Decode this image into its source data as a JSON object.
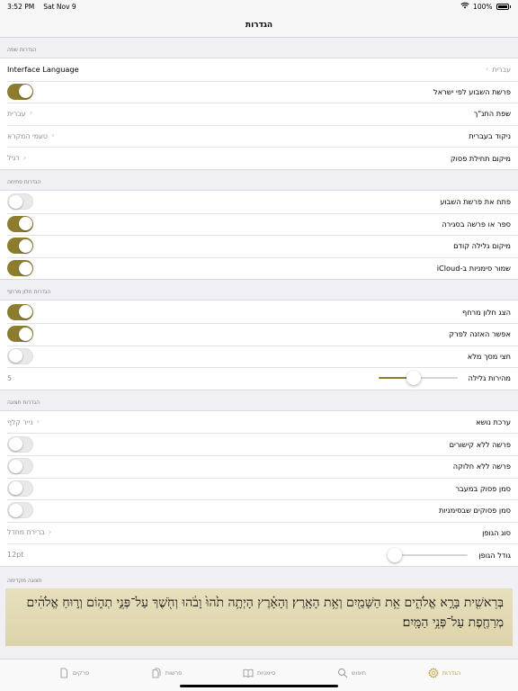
{
  "status": {
    "time": "3:52 PM",
    "date": "Sat Nov 9",
    "battery": "100%"
  },
  "nav": {
    "title": "הגדרות"
  },
  "sections": {
    "language": {
      "header": "הגדרות שפה",
      "interface_language": {
        "label": "Interface Language",
        "value": "עברית"
      },
      "israel_parasha": {
        "label": "פרשת השבוע לפי ישראל"
      },
      "tanakh_language": {
        "label": "שפת התנ\"ך",
        "value": "עברית"
      },
      "hebrew_nikud": {
        "label": "ניקוד בעברית",
        "value": "טעמי המקרא"
      },
      "verse_start": {
        "label": "מיקום תחילת פסוק",
        "value": "רגיל"
      }
    },
    "opening": {
      "header": "הגדרות פתיחה",
      "open_weekly": {
        "label": "פתח את פרשת השבוע"
      },
      "book_on_close": {
        "label": "ספר או פרשה בסגירה"
      },
      "previous_scroll": {
        "label": "מיקום גלילה קודם"
      },
      "icloud": {
        "label": "שמור סימניות ב-iCloud"
      }
    },
    "floating": {
      "header": "הגדרות חלון מרחף",
      "show_floating": {
        "label": "הצג חלון מרחף"
      },
      "allow_listen": {
        "label": "אפשר האזנה לפרק"
      },
      "half_screen": {
        "label": "חצי מסך מלא"
      },
      "scroll_speed": {
        "label": "מהירות גלילה",
        "value": "5",
        "level": 0.45
      }
    },
    "display": {
      "header": "הגדרות תצוגה",
      "theme": {
        "label": "ערכת נושא",
        "value": "נייר קלף"
      },
      "no_links": {
        "label": "פרשה ללא קישורים"
      },
      "no_division": {
        "label": "פרשה ללא חלוקה"
      },
      "mark_verse": {
        "label": "סמן פסוק במעבר"
      },
      "mark_bookmarks": {
        "label": "סמן פסוקים שבסימניות"
      },
      "font_type": {
        "label": "סוג הגופן",
        "value": "ברירת מחדל"
      },
      "font_size": {
        "label": "גודל הגופן",
        "value": "12pt",
        "level": 0.07
      }
    },
    "preview": {
      "header": "תצוגה מקדימה",
      "text": "בְּרֵאשִׁ֖ית בָּרָ֣א אֱלֹהִ֑ים אֵ֥ת הַשָּׁמַ֖יִם וְאֵ֥ת הָאָֽרֶץ׃ וְהָאָ֗רֶץ הָיְתָ֥ה תֹ֙הוּ֙ וָבֹ֔הוּ וְחֹ֖שֶׁךְ עַל־פְּנֵ֣י תְה֑וֹם וְר֣וּחַ אֱלֹהִ֔ים מְרַחֶ֖פֶת עַל־פְּנֵ֥י הַמָּֽיִם׃"
    }
  },
  "toggles": {
    "israel_parasha": true,
    "open_weekly": false,
    "book_on_close": true,
    "previous_scroll": true,
    "icloud": true,
    "show_floating": true,
    "allow_listen": true,
    "half_screen": false,
    "no_links": false,
    "no_division": false,
    "mark_verse": false,
    "mark_bookmarks": false
  },
  "tabs": [
    {
      "label": "הגדרות",
      "icon": "gear-icon",
      "active": true
    },
    {
      "label": "חיפוש",
      "icon": "search-icon",
      "active": false
    },
    {
      "label": "סימניות",
      "icon": "book-icon",
      "active": false
    },
    {
      "label": "פרשות",
      "icon": "documents-icon",
      "active": false
    },
    {
      "label": "פרקים",
      "icon": "document-icon",
      "active": false
    }
  ],
  "colors": {
    "accent": "#8c7d2e",
    "tab_active": "#b59a34",
    "parchment": "#e3dab6"
  }
}
